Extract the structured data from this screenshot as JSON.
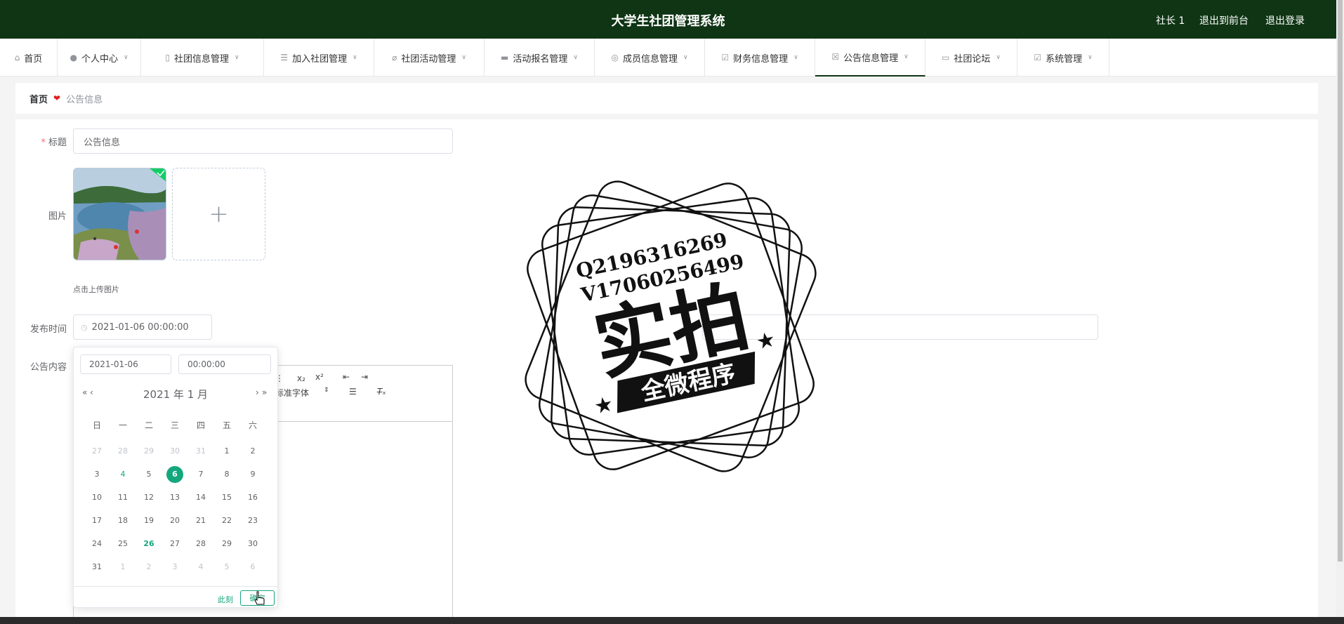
{
  "app": {
    "title": "大学生社团管理系统",
    "user_label": "社长 1",
    "to_front": "退出到前台",
    "logout": "退出登录"
  },
  "nav": [
    {
      "label": "首页",
      "icon": "home-icon",
      "caret": false
    },
    {
      "label": "个人中心",
      "icon": "user-icon",
      "caret": true
    },
    {
      "label": "社团信息管理",
      "icon": "phone-icon",
      "caret": true
    },
    {
      "label": "加入社团管理",
      "icon": "list-icon",
      "caret": true
    },
    {
      "label": "社团活动管理",
      "icon": "bell-off-icon",
      "caret": true
    },
    {
      "label": "活动报名管理",
      "icon": "briefcase-icon",
      "caret": true
    },
    {
      "label": "成员信息管理",
      "icon": "compass-icon",
      "caret": true
    },
    {
      "label": "财务信息管理",
      "icon": "checkbox-icon",
      "caret": true
    },
    {
      "label": "公告信息管理",
      "icon": "clipboard-x-icon",
      "caret": true,
      "active": true
    },
    {
      "label": "社团论坛",
      "icon": "chat-icon",
      "caret": true
    },
    {
      "label": "系统管理",
      "icon": "clipboard-check-icon",
      "caret": true
    }
  ],
  "breadcrumb": {
    "home": "首页",
    "current": "公告信息"
  },
  "form": {
    "title_label": "标题",
    "title_value": "公告信息",
    "image_label": "图片",
    "upload_hint": "点击上传图片",
    "publish_label": "发布时间",
    "publish_value": "2021-01-06 00:00:00",
    "content_label": "公告内容",
    "editor_font_label": "标准字体"
  },
  "datepicker": {
    "date_value": "2021-01-06",
    "time_value": "00:00:00",
    "header": "2021 年  1 月",
    "weekdays": [
      "日",
      "一",
      "二",
      "三",
      "四",
      "五",
      "六"
    ],
    "weeks": [
      [
        "27",
        "28",
        "29",
        "30",
        "31",
        "1",
        "2"
      ],
      [
        "3",
        "4",
        "5",
        "6",
        "7",
        "8",
        "9"
      ],
      [
        "10",
        "11",
        "12",
        "13",
        "14",
        "15",
        "16"
      ],
      [
        "17",
        "18",
        "19",
        "20",
        "21",
        "22",
        "23"
      ],
      [
        "24",
        "25",
        "26",
        "27",
        "28",
        "29",
        "30"
      ],
      [
        "31",
        "1",
        "2",
        "3",
        "4",
        "5",
        "6"
      ]
    ],
    "selected_day": "6",
    "today_day": "26",
    "now_label": "此刻",
    "confirm_label": "确定"
  },
  "watermark": {
    "line1": "Q2196316269",
    "line2": "V17060256499",
    "main": "实拍",
    "banner": "全微程序"
  },
  "colors": {
    "topbar": "#0f3514",
    "accent": "#14a77d",
    "required": "#f56c6c",
    "heart": "#e0201c"
  }
}
